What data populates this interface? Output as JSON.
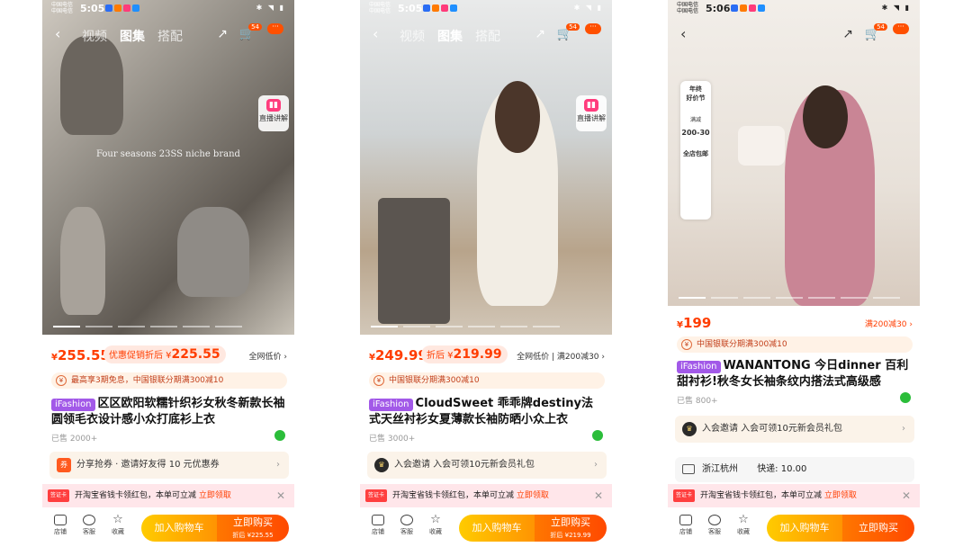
{
  "status": {
    "carrier": "中国电信\n中国电信",
    "phones": [
      {
        "time": "5:05"
      },
      {
        "time": "5:05"
      },
      {
        "time": "5:06"
      }
    ]
  },
  "nav": {
    "tabs": [
      "视频",
      "图集",
      "搭配"
    ],
    "cart_badge": "54",
    "more": "···"
  },
  "live": {
    "label": "直播讲解"
  },
  "products": [
    {
      "image_caption": "Four seasons 23SS  niche brand",
      "price_symbol": "¥",
      "price": "255.55",
      "discount_label": "优惠促销折后",
      "discount_price": "225.55",
      "price_right": "全网低价",
      "bank": "最高享3期免息，中国银联分期满300减10",
      "badge": "iFashion",
      "title": "区区欧阳软糯针织衫女秋冬新款长袖圆领毛衣设计感小众打底衫上衣",
      "sold": "已售 2000+",
      "member_icon": "券",
      "member_text": "分享抢券 · 邀请好友得 10 元优惠券",
      "redpacket_icon": "签证卡",
      "redpacket_text": "开淘宝省钱卡领红包，本单可立减",
      "redpacket_link": "立即领取",
      "shop": "店铺",
      "service": "客服",
      "fav": "收藏",
      "add_cart": "加入购物车",
      "buy_now": "立即购买",
      "buy_sub": "折后 ¥225.55"
    },
    {
      "image_caption": "",
      "price_symbol": "¥",
      "price": "249.99",
      "discount_label": "折后",
      "discount_price": "219.99",
      "price_right": "全网低价 | 满200减30",
      "bank": "中国银联分期满300减10",
      "badge": "iFashion",
      "title": "CloudSweet 乖乖牌destiny法式天丝衬衫女夏薄款长袖防晒小众上衣",
      "sold": "已售 3000+",
      "member_icon": "♛",
      "member_text": "入会邀请  入会可领10元新会员礼包",
      "redpacket_icon": "签证卡",
      "redpacket_text": "开淘宝省钱卡领红包，本单可立减",
      "redpacket_link": "立即领取",
      "shop": "店铺",
      "service": "客服",
      "fav": "收藏",
      "add_cart": "加入购物车",
      "buy_now": "立即购买",
      "buy_sub": "折后 ¥219.99"
    },
    {
      "promo_title": "年终\n好价节",
      "promo_tag": "满减",
      "promo_value": "200-30",
      "promo_free": "全店包邮",
      "price_symbol": "¥",
      "price": "199",
      "price_right": "满200减30",
      "bank": "中国银联分期满300减10",
      "badge": "iFashion",
      "title": "WANANTONG 今日dinner 百利甜衬衫!秋冬女长袖条纹内搭法式高级感",
      "sold": "已售 800+",
      "member_icon": "♛",
      "member_text": "入会邀请  入会可领10元新会员礼包",
      "ship_from": "浙江杭州",
      "ship_label": "快递:",
      "ship_fee": "10.00",
      "redpacket_icon": "签证卡",
      "redpacket_text": "开淘宝省钱卡领红包，本单可立减",
      "redpacket_link": "立即领取",
      "shop": "店铺",
      "service": "客服",
      "fav": "收藏",
      "add_cart": "加入购物车",
      "buy_now": "立即购买"
    }
  ],
  "colors": {
    "accent": "#ff5000",
    "price": "#ff3d00",
    "ifashion": "#a259e8",
    "cart_button": "#ffb000",
    "buy_button": "#ff5a00"
  }
}
